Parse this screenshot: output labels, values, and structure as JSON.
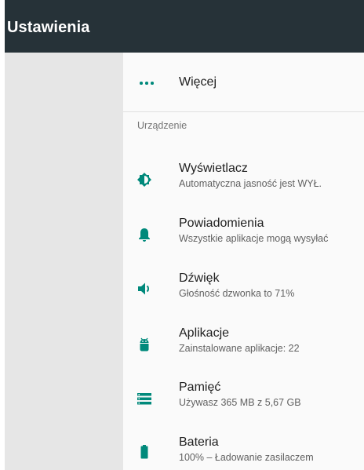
{
  "toolbar": {
    "title": "Ustawienia"
  },
  "more": {
    "label": "Więcej",
    "icon": "more-horiz-icon"
  },
  "section": {
    "header": "Urządzenie"
  },
  "items": [
    {
      "title": "Wyświetlacz",
      "subtitle": "Automatyczna jasność jest WYŁ.",
      "icon": "brightness-icon"
    },
    {
      "title": "Powiadomienia",
      "subtitle": "Wszystkie aplikacje mogą wysyłać",
      "icon": "bell-icon"
    },
    {
      "title": "Dźwięk",
      "subtitle": "Głośność dzwonka to 71%",
      "icon": "volume-icon"
    },
    {
      "title": "Aplikacje",
      "subtitle": "Zainstalowane aplikacje: 22",
      "icon": "android-icon"
    },
    {
      "title": "Pamięć",
      "subtitle": "Używasz 365 MB z 5,67 GB",
      "icon": "storage-icon"
    },
    {
      "title": "Bateria",
      "subtitle": "100% – Ładowanie zasilaczem",
      "icon": "battery-icon"
    }
  ],
  "colors": {
    "toolbar": "#263238",
    "accent": "#00897b",
    "left_pane": "#e6e6e6"
  }
}
